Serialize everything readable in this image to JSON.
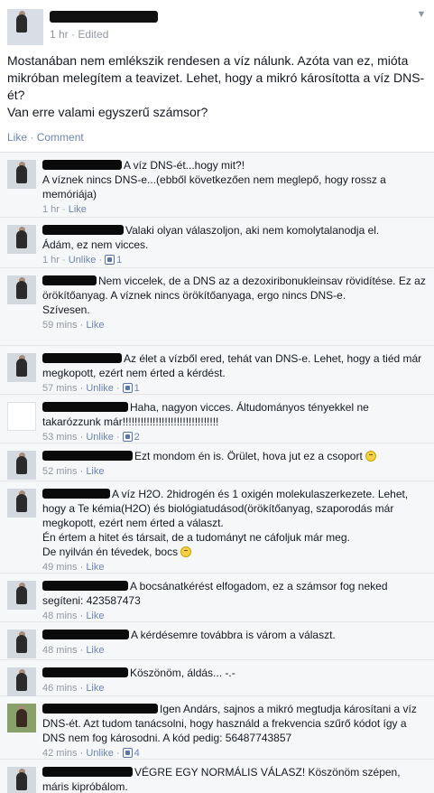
{
  "post": {
    "meta": "1 hr · Edited",
    "text": "Mostanában nem emlékszik rendesen a víz nálunk. Azóta van ez, mióta mikróban melegítem a teavizet. Lehet, hogy a mikró károsította a víz DNS-ét?\nVan erre valami egyszerű számsor?",
    "like_label": "Like",
    "comment_label": "Comment"
  },
  "comments": [
    {
      "text": "A víz DNS-ét...hogy mit?!\nA víznek nincs DNS-e...(ebből következően nem meglepő, hogy rossz a memóriája)",
      "time": "1 hr",
      "action": "Like",
      "likes": ""
    },
    {
      "text": "Valaki olyan válaszoljon, aki nem komolytalanodja el.\nÁdám, ez nem vicces.",
      "time": "1 hr",
      "action": "Unlike",
      "likes": "1"
    },
    {
      "text": "Nem viccelek, de a DNS az a dezoxiribonukleinsav rövidítése. Ez az örökítőanyag. A víznek nincs örökítőanyaga, ergo nincs DNS-e.\nSzívesen.",
      "time": "59 mins",
      "action": "Like",
      "likes": ""
    },
    {
      "text": "Az élet a vízből ered, tehát van DNS-e. Lehet, hogy a tiéd már megkopott, ezért nem érted a kérdést.",
      "time": "57 mins",
      "action": "Unlike",
      "likes": "1"
    },
    {
      "text": "Haha, nagyon vicces. Áltudományos tényekkel ne takarózzunk már!!!!!!!!!!!!!!!!!!!!!!!!!!!!!!!!",
      "time": "53 mins",
      "action": "Unlike",
      "likes": "2"
    },
    {
      "text": "Ezt mondom én is. Örület, hova jut ez a csoport",
      "time": "52 mins",
      "action": "Like",
      "likes": ""
    },
    {
      "text": "A víz H2O. 2hidrogén és 1 oxigén molekulaszerkezete. Lehet, hogy a Te kémia(H2O) és biológiatudásod(örökítőanyag, szaporodás már megkopott, ezért nem érted a választ.\nÉn értem a hitet és társait, de a tudományt ne cáfoljuk már meg.\nDe nyilván én tévedek, bocs",
      "time": "49 mins",
      "action": "Like",
      "likes": ""
    },
    {
      "text": "A bocsánatkérést elfogadom, ez a számsor fog neked segíteni: 423587473",
      "time": "48 mins",
      "action": "Like",
      "likes": ""
    },
    {
      "text": "A kérdésemre továbbra is várom a választ.",
      "time": "48 mins",
      "action": "Like",
      "likes": ""
    },
    {
      "text": "Köszönöm, áldás... -.-",
      "time": "46 mins",
      "action": "Like",
      "likes": ""
    },
    {
      "text": "Igen Andárs, sajnos a mikró megtudja károsítani a víz DNS-ét. Azt tudom tanácsolni, hogy használd a frekvencia szűrő kódot így a DNS nem fog károsodni. A kód pedig: 56487743857",
      "time": "42 mins",
      "action": "Unlike",
      "likes": "4"
    },
    {
      "text": "VÉGRE EGY NORMÁLIS VÁLASZ! Köszönöm szépen, máris kipróbálom.",
      "time": "",
      "action": "",
      "likes": ""
    }
  ]
}
